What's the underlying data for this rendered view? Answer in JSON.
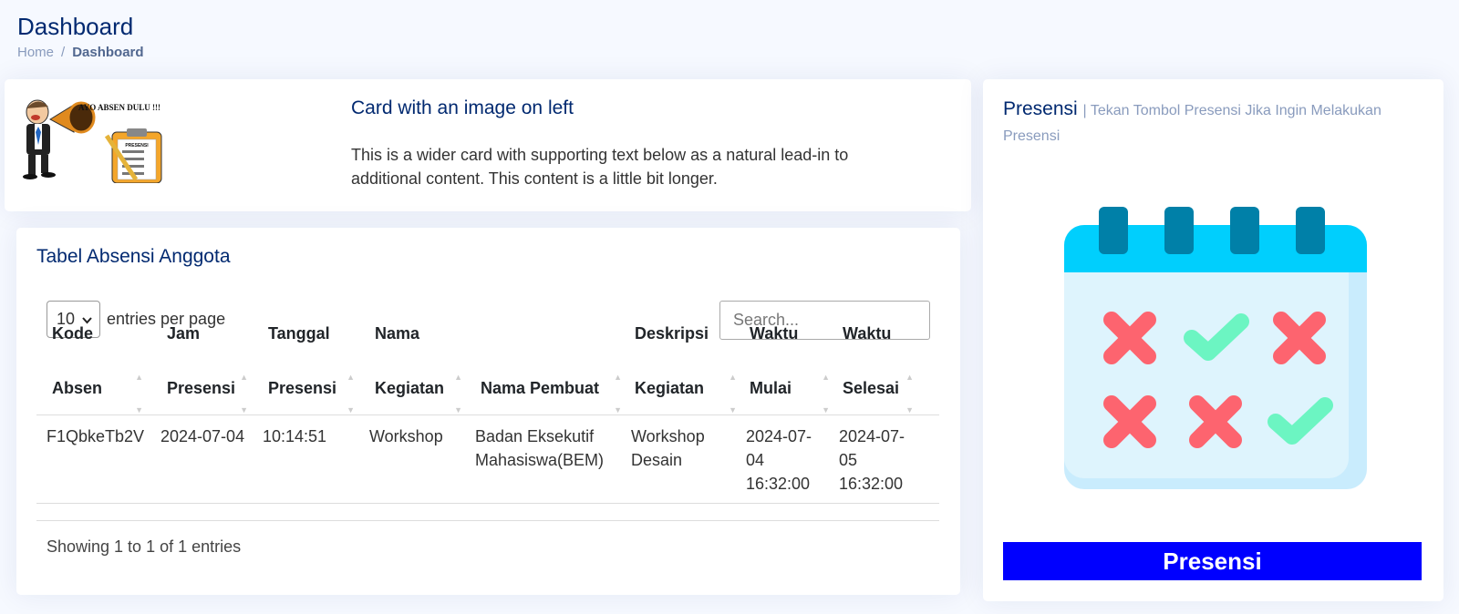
{
  "page": {
    "title": "Dashboard"
  },
  "breadcrumb": {
    "home": "Home",
    "current": "Dashboard"
  },
  "promo_card": {
    "banner_text": "AYO ABSEN DULU !!!",
    "clipboard_label": "PRESENSI",
    "title": "Card with an image on left",
    "text": "This is a wider card with supporting text below as a natural lead-in to additional content. This content is a little bit longer."
  },
  "attendance_table": {
    "title": "Tabel Absensi Anggota",
    "per_page_value": "10",
    "per_page_label": "entries per page",
    "search_placeholder": "Search...",
    "columns": [
      {
        "line1": "Kode",
        "line2": "Absen"
      },
      {
        "line1": "Jam",
        "line2": "Presensi"
      },
      {
        "line1": "Tanggal",
        "line2": "Presensi"
      },
      {
        "line1": "Nama",
        "line2": "Kegiatan"
      },
      {
        "line1": "",
        "line2": "Nama Pembuat"
      },
      {
        "line1": "Deskripsi",
        "line2": "Kegiatan"
      },
      {
        "line1": "Waktu",
        "line2": "Mulai"
      },
      {
        "line1": "Waktu",
        "line2": "Selesai"
      }
    ],
    "rows": [
      {
        "kode": "F1QbkeTb2V",
        "jam": "2024-07-04",
        "tanggal": "10:14:51",
        "nama_kegiatan": "Workshop",
        "pembuat": "Badan Eksekutif Mahasiswa(BEM)",
        "deskripsi": "Workshop Desain",
        "mulai": "2024-07-04 16:32:00",
        "selesai": "2024-07-05 16:32:00"
      }
    ],
    "info": "Showing 1 to 1 of 1 entries"
  },
  "presensi_card": {
    "title": "Presensi",
    "subtitle": "| Tekan Tombol Presensi Jika Ingin Melakukan Presensi",
    "button_label": "Presensi"
  },
  "colors": {
    "accent": "#012970",
    "button": "#0000ff",
    "calendar_header": "#00cffd",
    "cross": "#fd646f",
    "check": "#6cf5c2"
  }
}
